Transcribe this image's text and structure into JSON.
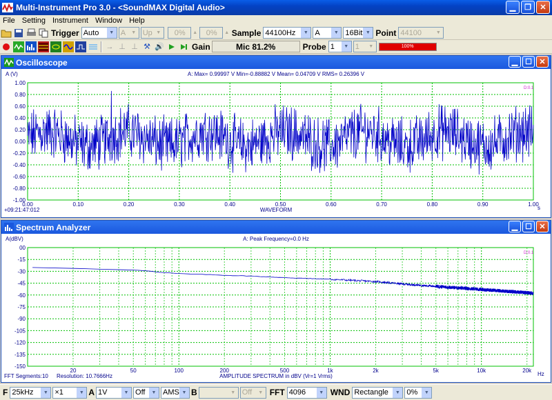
{
  "app": {
    "title": "Multi-Instrument Pro 3.0 - <SoundMAX Digital Audio>"
  },
  "menu": [
    "File",
    "Setting",
    "Instrument",
    "Window",
    "Help"
  ],
  "toolbar1": {
    "trigger_label": "Trigger",
    "trigger_mode": "Auto",
    "trigger_channel": "A",
    "trigger_edge": "Up",
    "trigger_level": "0%",
    "trigger_delay": "0%",
    "sample_label": "Sample",
    "sample_rate": "44100Hz",
    "channel": "A",
    "bits": "16Bit",
    "point_label": "Point",
    "points": "44100"
  },
  "toolbar2": {
    "gain_label": "Gain",
    "mic_level": "Mic 81.2%",
    "probe_label": "Probe",
    "probe_a": "1",
    "probe_b": "1",
    "level_meter_text": "100%",
    "level_meter_fraction": 1.0
  },
  "oscilloscope": {
    "title": "Oscilloscope",
    "stats": "A: Max= 0.99997 V  Min=-0.88882 V  Mean= 0.04709 V  RMS= 0.26396 V",
    "ylabel": "A (V)",
    "xlabel": "WAVEFORM",
    "xunit": "s",
    "timestamp": "+09:21:47:012",
    "legend_mark": "D:0.1"
  },
  "spectrum": {
    "title": "Spectrum Analyzer",
    "stats": "A: Peak Frequency=0.0 Hz",
    "ylabel": "A(dBV)",
    "xlabel": "AMPLITUDE SPECTRUM in dBV (Vr=1 Vrms)",
    "xunit": "Hz",
    "fft_segments": "FFT Segments:10",
    "resolution": "Resolution: 10.7666Hz",
    "legend_mark": "D:0.1"
  },
  "statusbar": {
    "f_label": "F",
    "freq_range": "25kHz",
    "zoom": "×1",
    "a_label": "A",
    "a_scale": "1V",
    "a_offset": "Off",
    "a_mode": "AMS",
    "b_label": "B",
    "b_scale": "",
    "b_offset": "Off",
    "fft_label": "FFT",
    "fft_size": "4096",
    "wnd_label": "WND",
    "window": "Rectangle",
    "overlap": "0%"
  },
  "colors": {
    "grid": "#00c000",
    "trace": "#0000c8",
    "title_bar": "#1a58de"
  },
  "chart_data": [
    {
      "type": "line",
      "title": "",
      "xlabel": "WAVEFORM",
      "ylabel": "A (V)",
      "xlim": [
        0,
        1.0
      ],
      "ylim": [
        -1.0,
        1.0
      ],
      "x_ticks": [
        "0.00",
        "0.10",
        "0.20",
        "0.30",
        "0.40",
        "0.50",
        "0.60",
        "0.70",
        "0.80",
        "0.90",
        "1.00"
      ],
      "y_ticks": [
        "1.00",
        "0.80",
        "0.60",
        "0.40",
        "0.20",
        "0.00",
        "-0.20",
        "-0.40",
        "-0.60",
        "-0.80",
        "-1.00"
      ],
      "grid": true,
      "series": [
        {
          "values": {
            "max": 0.99997,
            "min": -0.88882,
            "mean": 0.04709,
            "rms": 0.26396
          }
        }
      ]
    },
    {
      "type": "line",
      "title": "",
      "xlabel": "AMPLITUDE SPECTRUM in dBV (Vr=1 Vrms)",
      "ylabel": "A(dBV)",
      "xscale": "log",
      "xlim": [
        10,
        22050
      ],
      "ylim": [
        -150,
        0
      ],
      "x_ticks": [
        "20",
        "50",
        "100",
        "200",
        "500",
        "1k",
        "2k",
        "5k",
        "10k",
        "20k"
      ],
      "y_ticks": [
        "00",
        "-15",
        "-30",
        "-45",
        "-60",
        "-75",
        "-90",
        "-105",
        "-120",
        "-135",
        "-150"
      ],
      "grid": true,
      "series": [
        {
          "x": [
            10,
            20,
            30,
            40,
            60,
            70,
            100,
            150,
            200,
            300,
            500,
            700,
            1000,
            2000,
            3000,
            5000,
            10000,
            20000,
            22050
          ],
          "values": [
            -25,
            -26,
            -27,
            -28,
            -29,
            -31,
            -33,
            -34,
            -35,
            -36,
            -38,
            -39,
            -40,
            -43,
            -46,
            -49,
            -53,
            -57,
            -58
          ]
        }
      ]
    }
  ]
}
